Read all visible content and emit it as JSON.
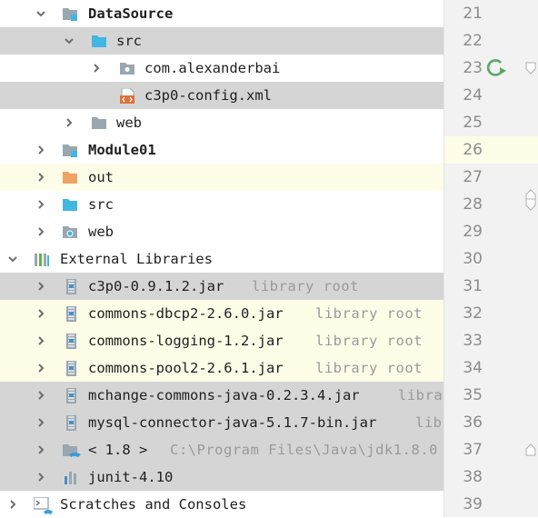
{
  "tree": {
    "rows": [
      {
        "label": "DataSource",
        "type": "module"
      },
      {
        "label": "src",
        "type": "folder-src"
      },
      {
        "label": "com.alexanderbai",
        "type": "package"
      },
      {
        "label": "c3p0-config.xml",
        "type": "xml"
      },
      {
        "label": "web",
        "type": "folder"
      },
      {
        "label": "Module01",
        "type": "module"
      },
      {
        "label": "out",
        "type": "folder-out"
      },
      {
        "label": "src",
        "type": "folder-src"
      },
      {
        "label": "web",
        "type": "folder-web"
      },
      {
        "label": "External Libraries",
        "type": "libraries"
      },
      {
        "label": "c3p0-0.9.1.2.jar",
        "hint": "library root",
        "type": "jar"
      },
      {
        "label": "commons-dbcp2-2.6.0.jar",
        "hint": "library root",
        "type": "jar"
      },
      {
        "label": "commons-logging-1.2.jar",
        "hint": "library root",
        "type": "jar"
      },
      {
        "label": "commons-pool2-2.6.1.jar",
        "hint": "library root",
        "type": "jar"
      },
      {
        "label": "mchange-commons-java-0.2.3.4.jar",
        "hint": "libra",
        "type": "jar"
      },
      {
        "label": "mysql-connector-java-5.1.7-bin.jar",
        "hint": "lib",
        "type": "jar"
      },
      {
        "label": "< 1.8 >",
        "hint": "C:\\Program Files\\Java\\jdk1.8.0",
        "type": "jdk"
      },
      {
        "label": "junit-4.10",
        "type": "junit"
      },
      {
        "label": "Scratches and Consoles",
        "type": "scratches"
      }
    ]
  },
  "gutter": {
    "lines": [
      "21",
      "22",
      "23",
      "24",
      "25",
      "26",
      "27",
      "28",
      "29",
      "30",
      "31",
      "32",
      "33",
      "34",
      "35",
      "36",
      "37",
      "38",
      "39"
    ]
  }
}
